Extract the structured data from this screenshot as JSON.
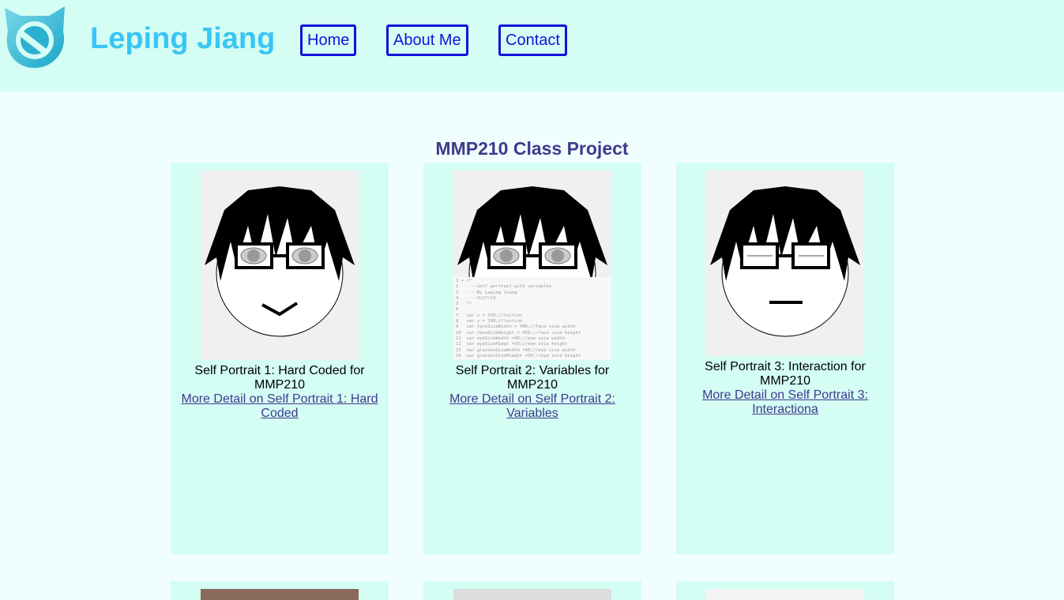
{
  "header": {
    "logo_icon": "cat-ear-logo-icon",
    "title": "Leping Jiang",
    "nav": [
      {
        "label": "Home"
      },
      {
        "label": "About Me"
      },
      {
        "label": "Contact"
      }
    ]
  },
  "main": {
    "section_title": "MMP210 Class Project",
    "cards": [
      {
        "caption": "Self Portrait 1: Hard Coded for MMP210",
        "link": "More Detail on Self Portrait 1: Hard Coded"
      },
      {
        "caption": "Self Portrait 2: Variables for MMP210",
        "link": "More Detail on Self Portrait 2: Variables",
        "code_lines": [
          "1 ▾ /*",
          "2   ----self portrait with variables",
          "3   ----By Leping Jiang",
          "4   ----9/17/19",
          "5   */",
          "6",
          "7   var x = 250;//loction",
          "8   var y = 300;//loction",
          "9   var faceSizeWidth = 400;//face size width",
          "10  var faceSizeHeight = 450;//face size height",
          "11  var eyeSizeWidth =40;//eye szie width",
          "12  var eyeSizeHiegt =50;//eye szie height",
          "13  var glassesSizeWidth =40;//eye szie width",
          "14  var glassesSizeHieght =50;//eye szie height"
        ]
      },
      {
        "caption": "Self Portrait 3: Interaction for MMP210",
        "link": "More Detail on Self Portrait 3: Interactiona"
      }
    ]
  },
  "colors": {
    "header_bg": "#d4fdf4",
    "page_bg": "#f0fffd",
    "title": "#38c6f5",
    "nav": "#1313d8",
    "heading": "#3f3a8c"
  }
}
